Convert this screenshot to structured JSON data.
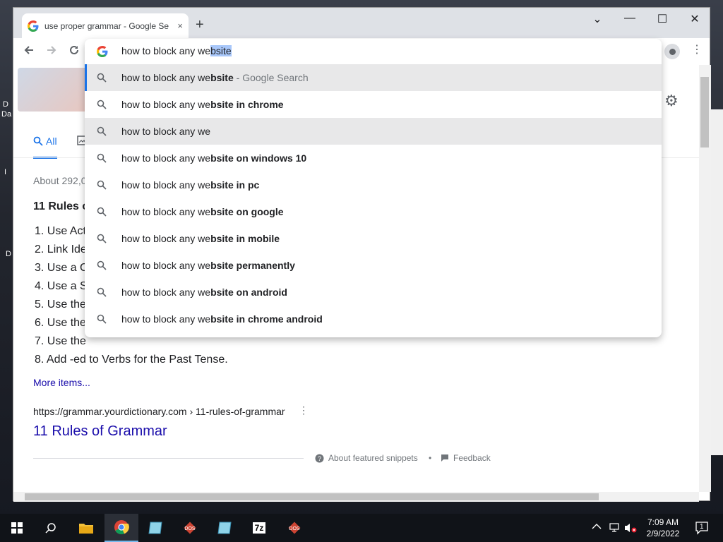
{
  "desktop": {
    "labels": [
      "D",
      "Da",
      "I",
      "D"
    ]
  },
  "browser": {
    "tab_title": "use proper grammar - Google Se",
    "tab_close": "×",
    "new_tab": "+",
    "window_controls": {
      "min": "—",
      "max": "☐",
      "close": "✕"
    },
    "chevron": "⌄"
  },
  "omnibox": {
    "typed": "how to block any we",
    "selected": "bsite",
    "suggestions": [
      {
        "prefix": "how to block any we",
        "bold": "bsite",
        "suffix": " - Google Search"
      },
      {
        "prefix": "how to block any we",
        "bold": "bsite in chrome",
        "suffix": ""
      },
      {
        "prefix": "how to block any we",
        "bold": "",
        "suffix": ""
      },
      {
        "prefix": "how to block any we",
        "bold": "bsite on windows 10",
        "suffix": ""
      },
      {
        "prefix": "how to block any we",
        "bold": "bsite in pc",
        "suffix": ""
      },
      {
        "prefix": "how to block any we",
        "bold": "bsite on google",
        "suffix": ""
      },
      {
        "prefix": "how to block any we",
        "bold": "bsite in mobile",
        "suffix": ""
      },
      {
        "prefix": "how to block any we",
        "bold": "bsite permanently",
        "suffix": ""
      },
      {
        "prefix": "how to block any we",
        "bold": "bsite on android",
        "suffix": ""
      },
      {
        "prefix": "how to block any we",
        "bold": "bsite in chrome android",
        "suffix": ""
      }
    ]
  },
  "page": {
    "tab_all": "All",
    "about": "About 292,0",
    "snippet_title": "11 Rules of",
    "rules": [
      "1. Use Act",
      "2. Link Ide",
      "3. Use a C",
      "4. Use a S",
      "5. Use the",
      "6. Use the",
      "7. Use the",
      "8. Add -ed to Verbs for the Past Tense."
    ],
    "more_items": "More items...",
    "cite_url": "https://grammar.yourdictionary.com › 11-rules-of-grammar",
    "result_title": "11 Rules of Grammar",
    "about_snippets": "About featured snippets",
    "bullet": "•",
    "feedback": "Feedback"
  },
  "taskbar": {
    "time": "7:09 AM",
    "date": "2/9/2022",
    "notification_count": "1",
    "sevenzip_label": "7z"
  },
  "colors": {
    "accent": "#1a73e8",
    "link": "#1a0dab",
    "selection": "#a8c7fa",
    "highlight_row": "#e8e8e9",
    "taskbar": "#101318"
  }
}
